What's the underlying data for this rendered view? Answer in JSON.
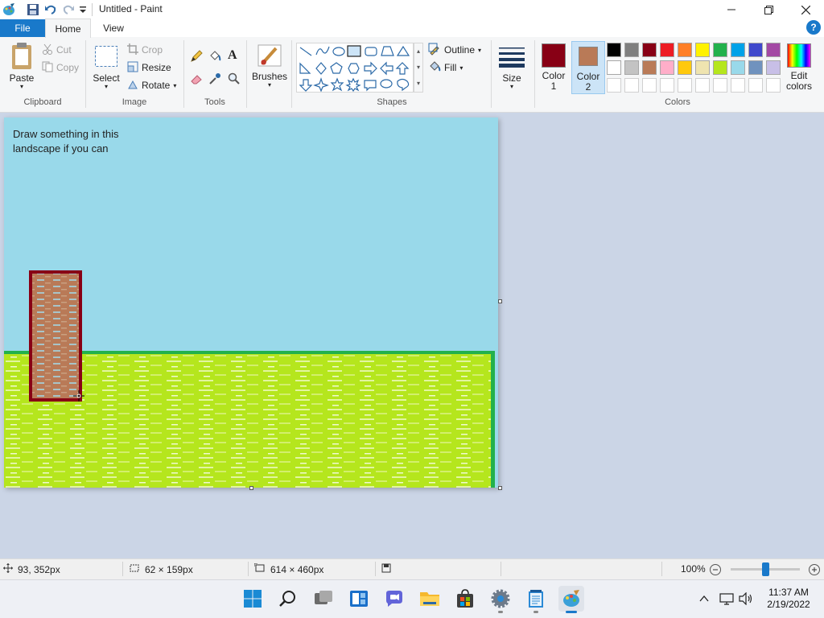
{
  "window": {
    "title": "Untitled - Paint"
  },
  "tabs": {
    "file": "File",
    "home": "Home",
    "view": "View"
  },
  "clipboard": {
    "paste": "Paste",
    "cut": "Cut",
    "copy": "Copy",
    "label": "Clipboard"
  },
  "image": {
    "select": "Select",
    "crop": "Crop",
    "resize": "Resize",
    "rotate": "Rotate",
    "label": "Image"
  },
  "tools": {
    "label": "Tools"
  },
  "brushes": {
    "label": "Brushes"
  },
  "shapes": {
    "outline": "Outline",
    "fill": "Fill",
    "label": "Shapes"
  },
  "size": {
    "label": "Size"
  },
  "colors": {
    "color1_label": "Color",
    "color1_num": "1",
    "color2_label": "Color",
    "color2_num": "2",
    "edit_label": "Edit",
    "edit_label2": "colors",
    "label": "Colors",
    "color1_value": "#880015",
    "color2_value": "#b97a57",
    "palette_row1": [
      "#000000",
      "#7f7f7f",
      "#880015",
      "#ed1c24",
      "#ff7f27",
      "#fff200",
      "#22b14c",
      "#00a2e8",
      "#3f48cc",
      "#a349a4"
    ],
    "palette_row2": [
      "#ffffff",
      "#c3c3c3",
      "#b97a57",
      "#ffaec9",
      "#ffc90e",
      "#efe4b0",
      "#b5e61d",
      "#99d9ea",
      "#7092be",
      "#c8bfe7"
    ],
    "palette_row3": [
      "#ffffff",
      "#ffffff",
      "#ffffff",
      "#ffffff",
      "#ffffff",
      "#ffffff",
      "#ffffff",
      "#ffffff",
      "#ffffff",
      "#ffffff"
    ]
  },
  "canvas": {
    "text_line1": "Draw something in this",
    "text_line2": "landscape if you can",
    "sky_color": "#99d9ea",
    "grass_color": "#b5e61d",
    "line_color": "#22b14c",
    "rect_color": "#880015"
  },
  "status": {
    "cursor_pos": "93, 352px",
    "selection_size": "62 × 159px",
    "image_size": "614 × 460px",
    "zoom": "100%",
    "zoom_level": 0.5
  },
  "clock": {
    "time": "11:37 AM",
    "date": "2/19/2022"
  }
}
